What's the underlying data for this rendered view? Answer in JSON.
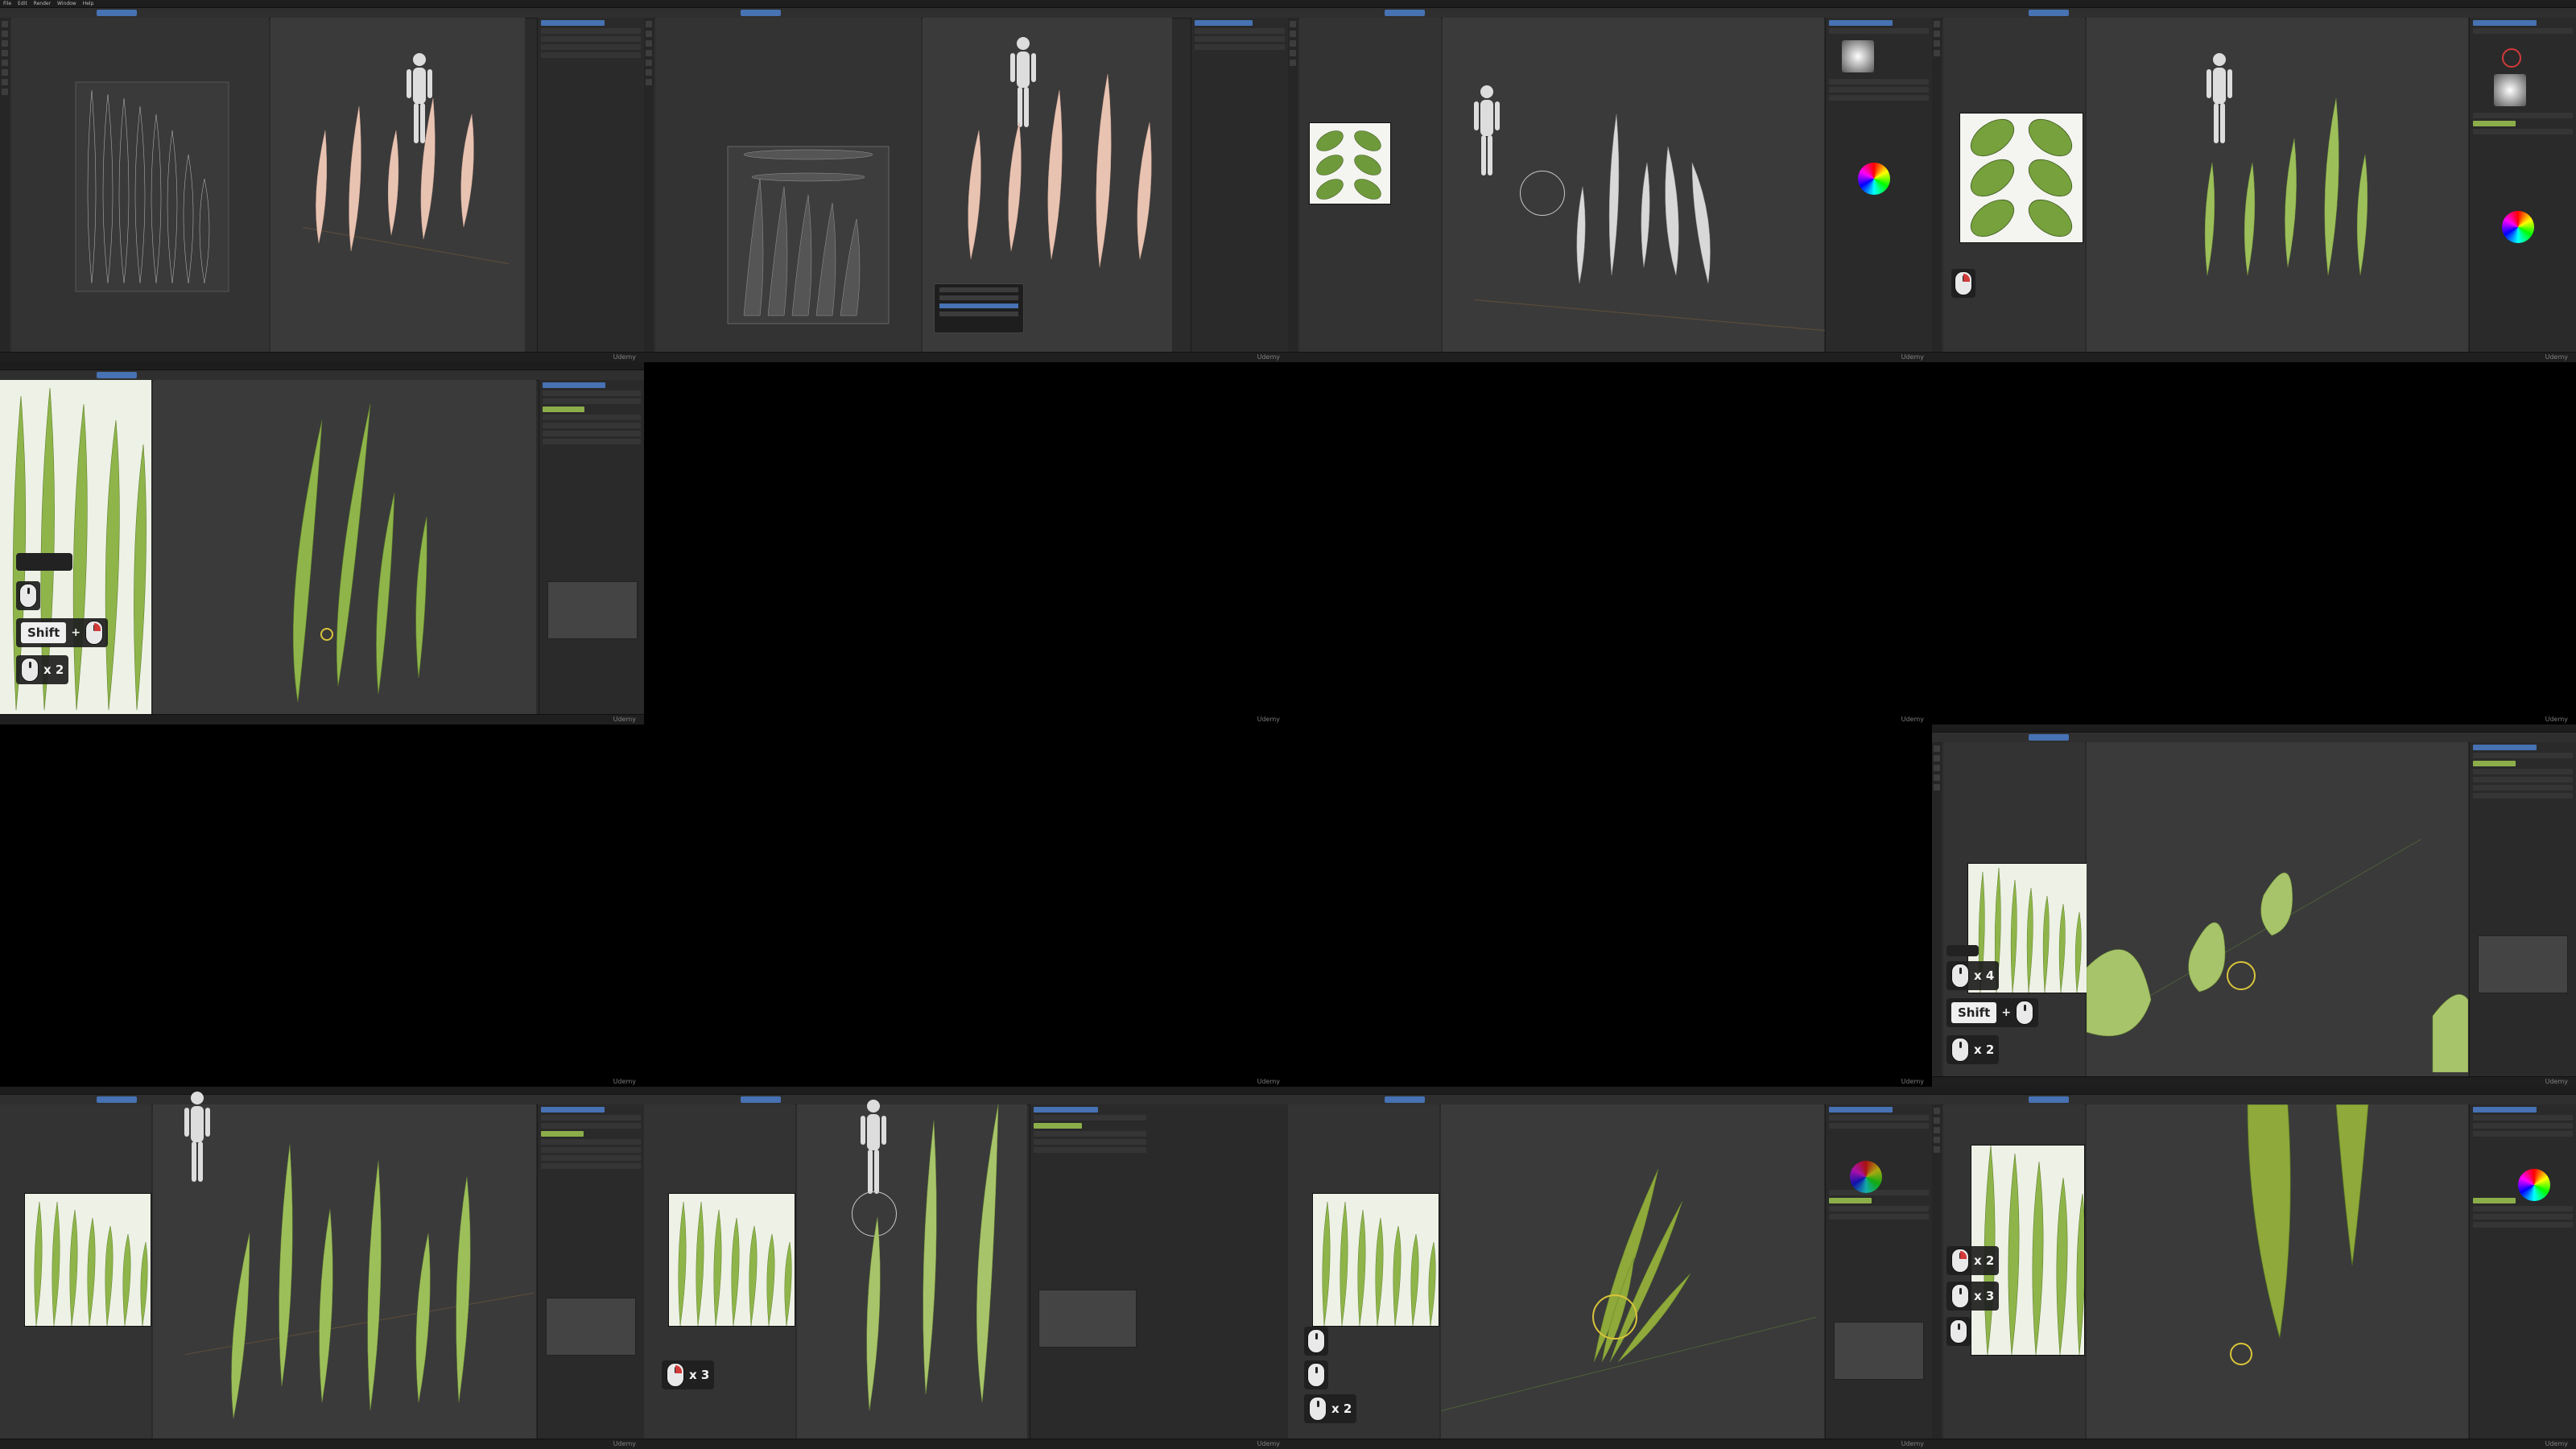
{
  "app": {
    "menu": [
      "File",
      "Edit",
      "Render",
      "Window",
      "Help"
    ]
  },
  "watermark": "Udemy",
  "frames": {
    "f1": {
      "state": "uv-islands-wireframe"
    },
    "f2": {
      "state": "uv-islands-with-popup"
    },
    "f3": {
      "state": "leaf-texture-assigned-white"
    },
    "f4": {
      "state": "leaf-texture-painted-green"
    },
    "f5": {
      "badges": [
        {
          "shift": "Shift",
          "plus": "+"
        },
        {
          "count": "x 2"
        }
      ]
    },
    "f12": {
      "badges": [
        {
          "count": "x 4"
        },
        {
          "shift": "Shift",
          "plus": "+"
        },
        {
          "count": "x 2"
        }
      ]
    },
    "f13": {
      "state": "grass-texture-painted"
    },
    "f14": {
      "badges": [
        {
          "count": "x 3"
        }
      ]
    },
    "f15": {
      "badges": [
        {
          "count": "x 2"
        }
      ]
    },
    "f16": {
      "badges": [
        {
          "count": "x 2"
        },
        {
          "count": "x 3"
        }
      ]
    }
  },
  "colors": {
    "accent": "#4772b3",
    "leaf_green": "#9dbf5a",
    "leaf_peach": "#e9c3b2",
    "cursor_yellow": "#d9c43a",
    "mouse_red": "#d23a3a"
  }
}
